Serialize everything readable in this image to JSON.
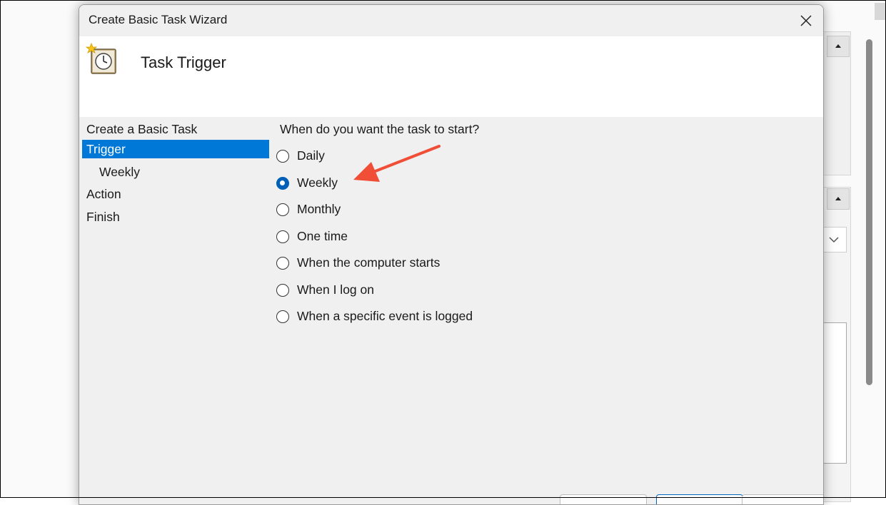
{
  "window": {
    "title": "Create Basic Task Wizard"
  },
  "header": {
    "title": "Task Trigger",
    "icon": "task-clock-icon"
  },
  "nav": {
    "items": [
      {
        "label": "Create a Basic Task",
        "selected": false,
        "sub": false
      },
      {
        "label": "Trigger",
        "selected": true,
        "sub": false
      },
      {
        "label": "Weekly",
        "selected": false,
        "sub": true
      },
      {
        "label": "Action",
        "selected": false,
        "sub": false
      },
      {
        "label": "Finish",
        "selected": false,
        "sub": false
      }
    ]
  },
  "content": {
    "question": "When do you want the task to start?",
    "options": [
      {
        "label": "Daily",
        "checked": false
      },
      {
        "label": "Weekly",
        "checked": true
      },
      {
        "label": "Monthly",
        "checked": false
      },
      {
        "label": "One time",
        "checked": false
      },
      {
        "label": "When the computer starts",
        "checked": false
      },
      {
        "label": "When I log on",
        "checked": false
      },
      {
        "label": "When a specific event is logged",
        "checked": false
      }
    ]
  },
  "colors": {
    "accent": "#0078d7",
    "annotation_arrow": "#f04e37",
    "dialog_bg": "#f0f0f0"
  }
}
